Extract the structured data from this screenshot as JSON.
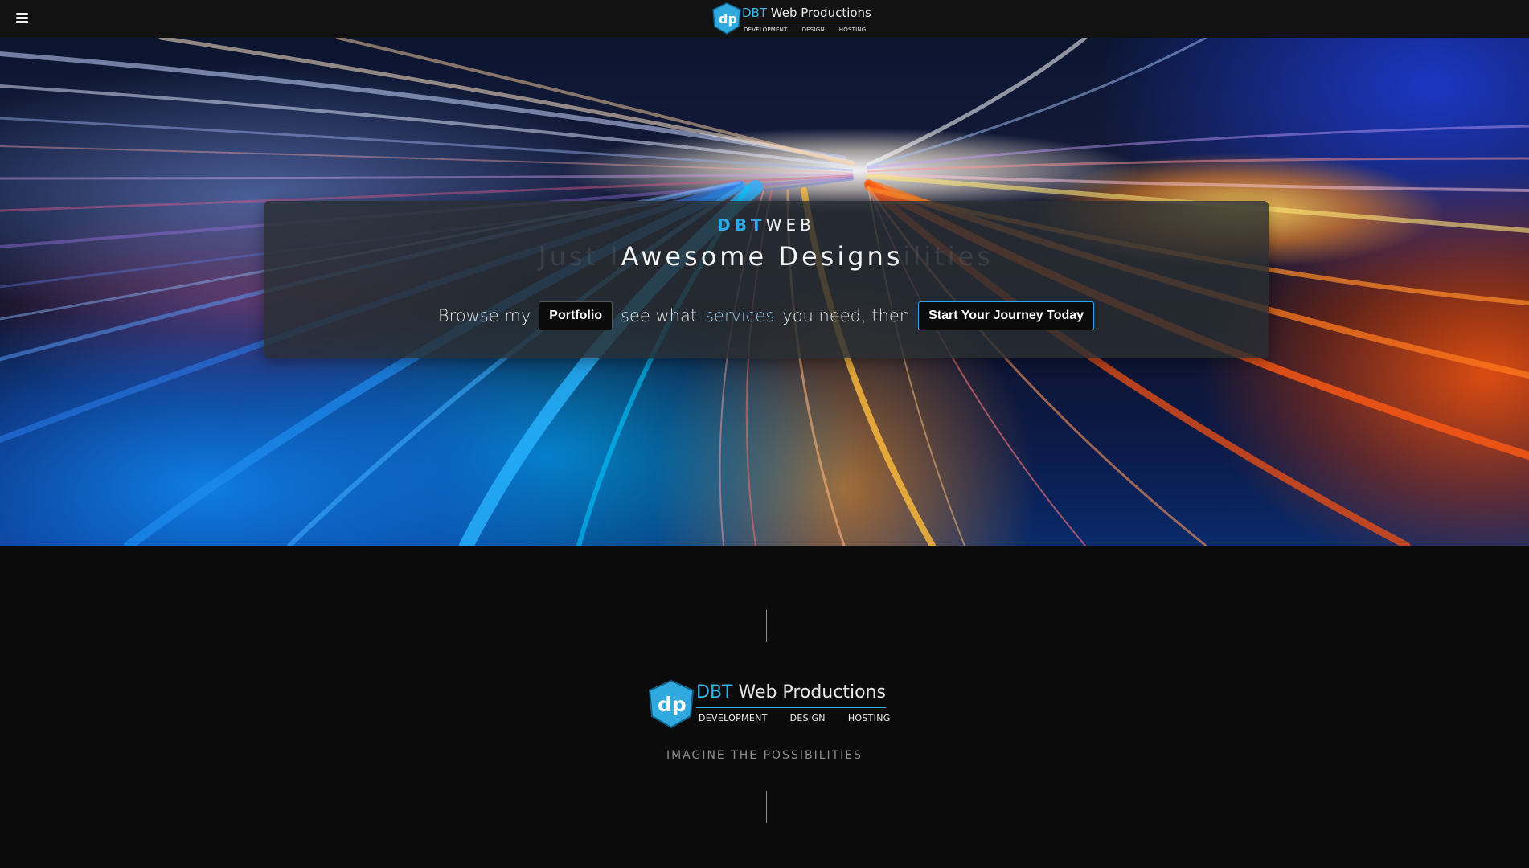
{
  "navbar": {
    "menu_icon": "hamburger-menu-icon",
    "logo": {
      "brand_accent": "DBT",
      "brand_rest": " Web Productions",
      "tags": [
        "DEVELOPMENT",
        "DESIGN",
        "HOSTING"
      ],
      "monogram": "dp"
    }
  },
  "hero": {
    "eyebrow_accent": "DBT",
    "eyebrow_rest": "WEB",
    "rotator_before": "Just I",
    "rotator_main": "Awesome Designs",
    "rotator_after": "ilities",
    "cta": {
      "prefix": "Browse my",
      "portfolio_button": "Portfolio",
      "middle_1": "see what",
      "services_link": "services",
      "middle_2": "you need, then",
      "journey_button": "Start Your Journey Today"
    }
  },
  "lower": {
    "logo": {
      "brand_accent": "DBT",
      "brand_rest": " Web Productions",
      "tags": [
        "DEVELOPMENT",
        "DESIGN",
        "HOSTING"
      ],
      "monogram": "dp"
    },
    "tagline": "IMAGINE THE POSSIBILITIES"
  },
  "colors": {
    "accent": "#2da7e6",
    "navbar_bg": "#121212",
    "page_bg": "#0b0b0c",
    "card_bg": "rgba(42,46,50,0.82)"
  }
}
